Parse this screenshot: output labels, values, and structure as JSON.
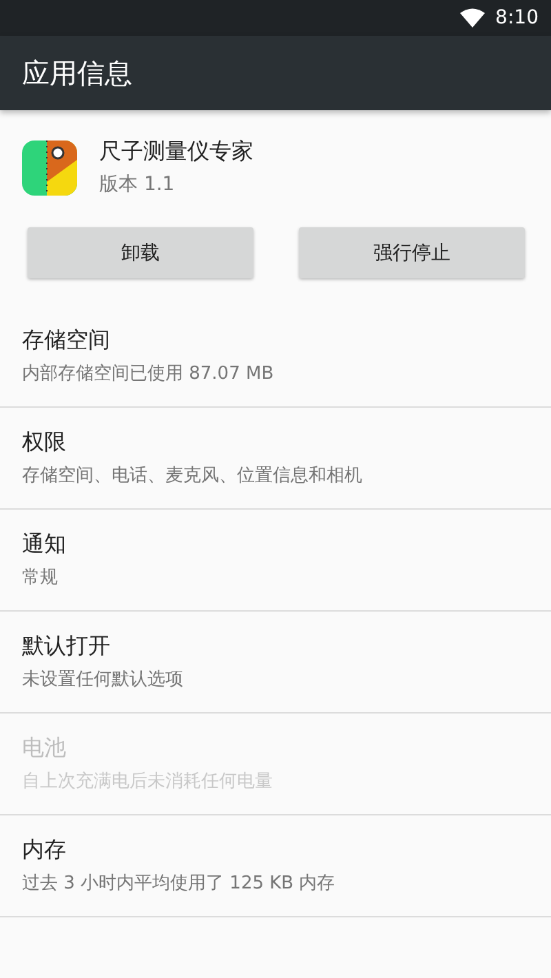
{
  "status_bar": {
    "time": "8:10"
  },
  "app_bar": {
    "title": "应用信息"
  },
  "app": {
    "name": "尺子测量仪专家",
    "version": "版本 1.1"
  },
  "buttons": [
    {
      "label": "卸载"
    },
    {
      "label": "强行停止"
    }
  ],
  "settings": [
    {
      "title": "存储空间",
      "summary": "内部存储空间已使用 87.07 MB",
      "disabled": false
    },
    {
      "title": "权限",
      "summary": "存储空间、电话、麦克风、位置信息和相机",
      "disabled": false
    },
    {
      "title": "通知",
      "summary": "常规",
      "disabled": false
    },
    {
      "title": "默认打开",
      "summary": "未设置任何默认选项",
      "disabled": false
    },
    {
      "title": "电池",
      "summary": "自上次充满电后未消耗任何电量",
      "disabled": true
    },
    {
      "title": "内存",
      "summary": "过去 3 小时内平均使用了 125 KB 内存",
      "disabled": false
    }
  ]
}
